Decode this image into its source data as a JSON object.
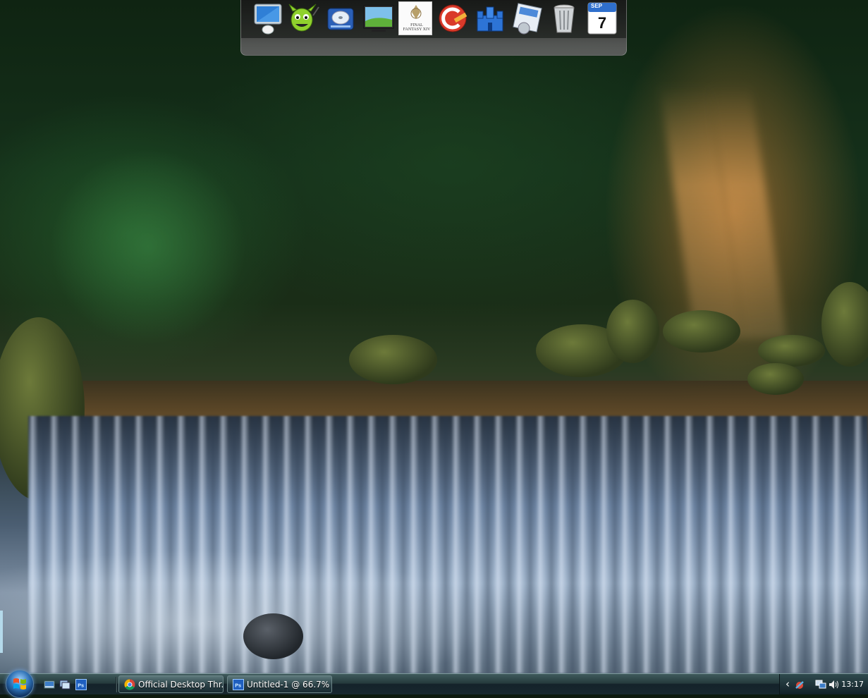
{
  "desktop": {
    "wallpaper": "forest waterfall"
  },
  "dock": {
    "items": [
      {
        "name": "Computer",
        "icon": "computer-monitor-icon"
      },
      {
        "name": "Downloader",
        "icon": "green-monster-icon"
      },
      {
        "name": "Drive",
        "icon": "hard-drive-icon"
      },
      {
        "name": "Desktop",
        "icon": "desktop-landscape-icon"
      },
      {
        "name": "Final Fantasy XIV",
        "icon": "final-fantasy-icon",
        "label": "FINAL FANTASY XIV"
      },
      {
        "name": "CCleaner",
        "icon": "ccleaner-icon"
      },
      {
        "name": "Network",
        "icon": "blue-castle-icon"
      },
      {
        "name": "Control Panel",
        "icon": "control-panel-icon"
      },
      {
        "name": "Recycle Bin",
        "icon": "trash-can-icon"
      },
      {
        "name": "Calendar",
        "icon": "calendar-icon",
        "month": "SEP",
        "day": "7"
      }
    ]
  },
  "taskbar": {
    "quick_launch": [
      "show-desktop-icon",
      "switch-windows-icon",
      "photoshop-icon"
    ],
    "tasks": [
      {
        "label": "Official Desktop Thr...",
        "icon": "chrome-icon"
      },
      {
        "label": "Untitled-1 @ 66.7% ...",
        "icon": "photoshop-icon"
      }
    ],
    "tray": {
      "chevron": "‹",
      "time": "13:17"
    }
  },
  "colors": {
    "taskbar": "#1b2c32",
    "dock_bg": "#1e1e1e",
    "photoshop_blue": "#1f5fbf"
  }
}
